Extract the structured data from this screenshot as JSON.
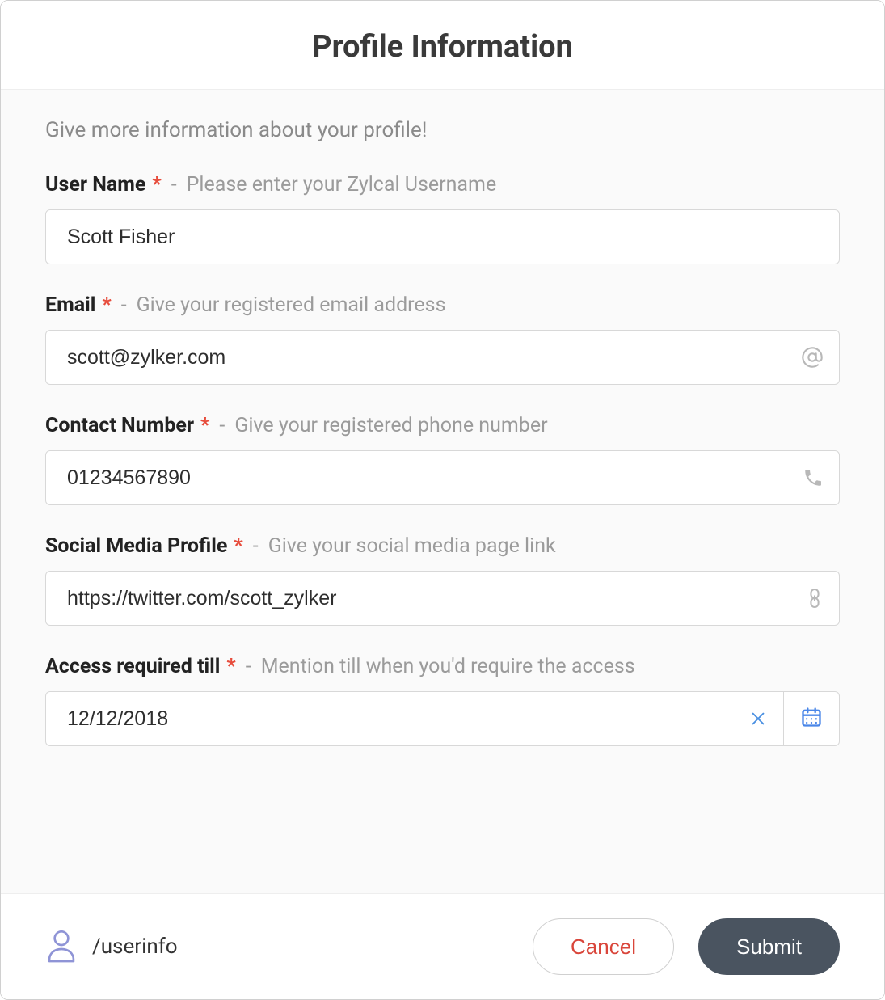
{
  "dialog": {
    "title": "Profile Information",
    "intro": "Give more information about your profile!"
  },
  "fields": {
    "username": {
      "label": "User Name",
      "hint": "Please enter your Zylcal Username",
      "value": "Scott Fisher"
    },
    "email": {
      "label": "Email",
      "hint": "Give your registered email address",
      "value": "scott@zylker.com"
    },
    "contact": {
      "label": "Contact Number",
      "hint": "Give your registered phone number",
      "value": "01234567890"
    },
    "social": {
      "label": "Social Media Profile",
      "hint": "Give your social media page link",
      "value": "https://twitter.com/scott_zylker"
    },
    "access": {
      "label": "Access required till",
      "hint": "Mention till when you'd require the access",
      "value": "12/12/2018"
    }
  },
  "footer": {
    "command": "/userinfo",
    "cancel": "Cancel",
    "submit": "Submit"
  },
  "glyphs": {
    "required": "*",
    "sep": "-"
  }
}
